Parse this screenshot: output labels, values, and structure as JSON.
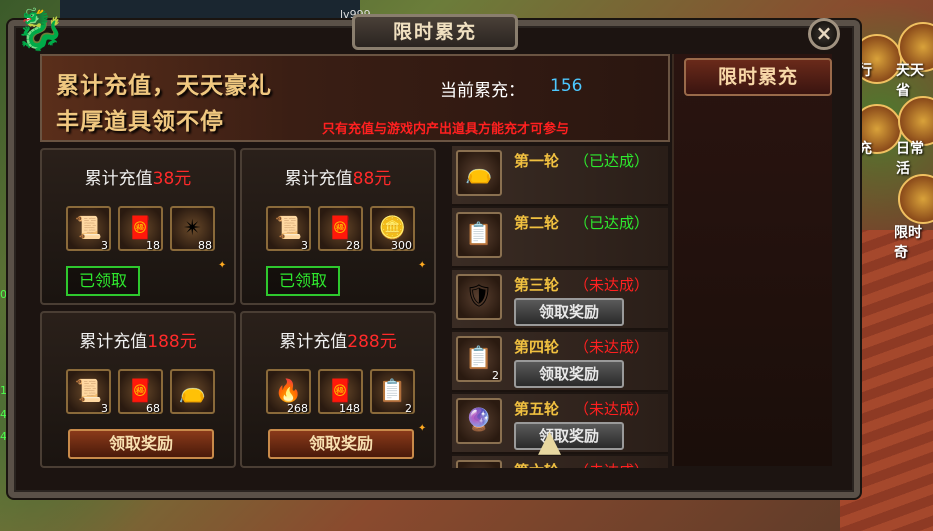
{
  "window": {
    "title": "限时累充",
    "close_label": "×"
  },
  "hud": {
    "level": "lv999"
  },
  "banner": {
    "line1": "累计充值，天天豪礼",
    "line2": "丰厚道具领不停",
    "current_label": "当前累充：",
    "current_value": "156",
    "notice": "只有充值与游戏内产出道具方能充才可参与"
  },
  "cards": [
    {
      "label": "累计充值",
      "amount": "38元",
      "status": "已领取",
      "items": [
        {
          "icon": "scroll-icon",
          "count": "3"
        },
        {
          "icon": "rolled-scroll-icon",
          "count": "18"
        },
        {
          "icon": "points-emblem-icon",
          "count": "88"
        }
      ]
    },
    {
      "label": "累计充值",
      "amount": "88元",
      "status": "已领取",
      "items": [
        {
          "icon": "scroll-icon",
          "count": "3"
        },
        {
          "icon": "rolled-scroll-icon",
          "count": "28"
        },
        {
          "icon": "gold-ingot-icon",
          "count": "300"
        }
      ]
    },
    {
      "label": "累计充值",
      "amount": "188元",
      "button": "领取奖励",
      "items": [
        {
          "icon": "scroll-icon",
          "count": "3"
        },
        {
          "icon": "rolled-scroll-icon",
          "count": "68"
        },
        {
          "icon": "treasure-bag-icon",
          "count": ""
        }
      ]
    },
    {
      "label": "累计充值",
      "amount": "288元",
      "button": "领取奖励",
      "items": [
        {
          "icon": "blue-flame-icon",
          "count": "268"
        },
        {
          "icon": "rolled-scroll-icon",
          "count": "148"
        },
        {
          "icon": "tablet-icon",
          "count": "2"
        }
      ]
    }
  ],
  "rounds": [
    {
      "name": "第一轮",
      "status": "（已达成）",
      "achieved": true,
      "icon": "treasure-bag-icon",
      "count": ""
    },
    {
      "name": "第二轮",
      "status": "（已达成）",
      "achieved": true,
      "icon": "tablet-icon",
      "count": ""
    },
    {
      "name": "第三轮",
      "status": "（未达成）",
      "achieved": false,
      "icon": "armor-icon",
      "count": "",
      "button": "领取奖励"
    },
    {
      "name": "第四轮",
      "status": "（未达成）",
      "achieved": false,
      "icon": "tablet-icon",
      "count": "2",
      "button": "领取奖励"
    },
    {
      "name": "第五轮",
      "status": "（未达成）",
      "achieved": false,
      "icon": "purple-orb-icon",
      "count": "",
      "button": "领取奖励"
    },
    {
      "name": "第六轮",
      "status": "（未达成）",
      "achieved": false,
      "icon": "scroll-icon",
      "count": ""
    }
  ],
  "sidebar": {
    "tab_label": "限时累充"
  },
  "side_icons": [
    {
      "label": "行"
    },
    {
      "label": "天天省"
    },
    {
      "label": "充"
    },
    {
      "label": "日常活"
    },
    {
      "label": "限时奇"
    }
  ]
}
